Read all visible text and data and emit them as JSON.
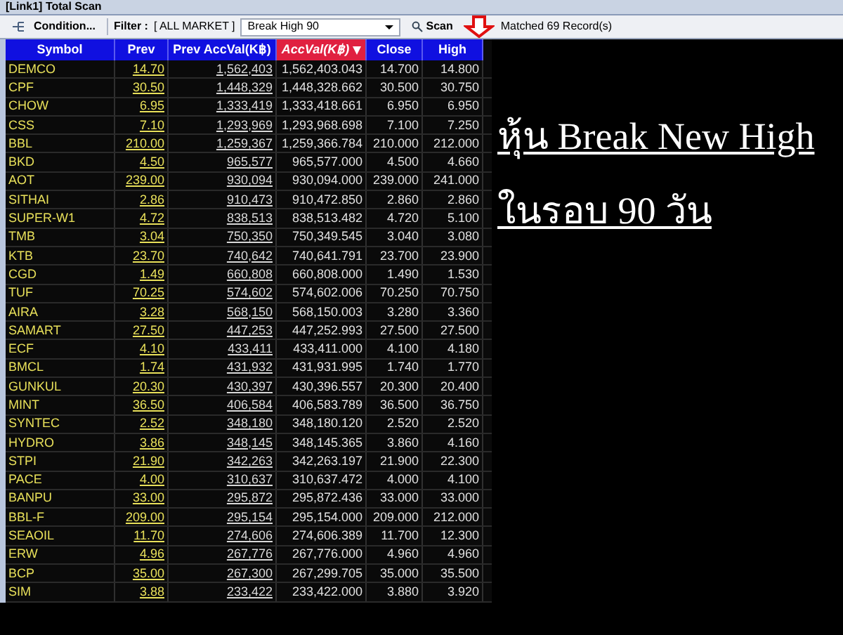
{
  "window": {
    "title": "[Link1] Total Scan"
  },
  "toolbar": {
    "condition_button": "Condition...",
    "filter_label": "Filter :",
    "market": "[ ALL MARKET ]",
    "scan_type": "Break High 90",
    "scan_button": "Scan",
    "result": "Matched 69 Record(s)"
  },
  "table": {
    "columns": [
      {
        "label": "Symbol",
        "sorted": false
      },
      {
        "label": "Prev",
        "sorted": false
      },
      {
        "label": "Prev AccVal(K฿)",
        "sorted": false
      },
      {
        "label": "AccVal(K฿)",
        "sorted": true
      },
      {
        "label": "Close",
        "sorted": false
      },
      {
        "label": "High",
        "sorted": false
      }
    ],
    "rows": [
      [
        "DEMCO",
        "14.70",
        "1,562,403",
        "1,562,403.043",
        "14.700",
        "14.800"
      ],
      [
        "CPF",
        "30.50",
        "1,448,329",
        "1,448,328.662",
        "30.500",
        "30.750"
      ],
      [
        "CHOW",
        "6.95",
        "1,333,419",
        "1,333,418.661",
        "6.950",
        "6.950"
      ],
      [
        "CSS",
        "7.10",
        "1,293,969",
        "1,293,968.698",
        "7.100",
        "7.250"
      ],
      [
        "BBL",
        "210.00",
        "1,259,367",
        "1,259,366.784",
        "210.000",
        "212.000"
      ],
      [
        "BKD",
        "4.50",
        "965,577",
        "965,577.000",
        "4.500",
        "4.660"
      ],
      [
        "AOT",
        "239.00",
        "930,094",
        "930,094.000",
        "239.000",
        "241.000"
      ],
      [
        "SITHAI",
        "2.86",
        "910,473",
        "910,472.850",
        "2.860",
        "2.860"
      ],
      [
        "SUPER-W1",
        "4.72",
        "838,513",
        "838,513.482",
        "4.720",
        "5.100"
      ],
      [
        "TMB",
        "3.04",
        "750,350",
        "750,349.545",
        "3.040",
        "3.080"
      ],
      [
        "KTB",
        "23.70",
        "740,642",
        "740,641.791",
        "23.700",
        "23.900"
      ],
      [
        "CGD",
        "1.49",
        "660,808",
        "660,808.000",
        "1.490",
        "1.530"
      ],
      [
        "TUF",
        "70.25",
        "574,602",
        "574,602.006",
        "70.250",
        "70.750"
      ],
      [
        "AIRA",
        "3.28",
        "568,150",
        "568,150.003",
        "3.280",
        "3.360"
      ],
      [
        "SAMART",
        "27.50",
        "447,253",
        "447,252.993",
        "27.500",
        "27.500"
      ],
      [
        "ECF",
        "4.10",
        "433,411",
        "433,411.000",
        "4.100",
        "4.180"
      ],
      [
        "BMCL",
        "1.74",
        "431,932",
        "431,931.995",
        "1.740",
        "1.770"
      ],
      [
        "GUNKUL",
        "20.30",
        "430,397",
        "430,396.557",
        "20.300",
        "20.400"
      ],
      [
        "MINT",
        "36.50",
        "406,584",
        "406,583.789",
        "36.500",
        "36.750"
      ],
      [
        "SYNTEC",
        "2.52",
        "348,180",
        "348,180.120",
        "2.520",
        "2.520"
      ],
      [
        "HYDRO",
        "3.86",
        "348,145",
        "348,145.365",
        "3.860",
        "4.160"
      ],
      [
        "STPI",
        "21.90",
        "342,263",
        "342,263.197",
        "21.900",
        "22.300"
      ],
      [
        "PACE",
        "4.00",
        "310,637",
        "310,637.472",
        "4.000",
        "4.100"
      ],
      [
        "BANPU",
        "33.00",
        "295,872",
        "295,872.436",
        "33.000",
        "33.000"
      ],
      [
        "BBL-F",
        "209.00",
        "295,154",
        "295,154.000",
        "209.000",
        "212.000"
      ],
      [
        "SEAOIL",
        "11.70",
        "274,606",
        "274,606.389",
        "11.700",
        "12.300"
      ],
      [
        "ERW",
        "4.96",
        "267,776",
        "267,776.000",
        "4.960",
        "4.960"
      ],
      [
        "BCP",
        "35.00",
        "267,300",
        "267,299.705",
        "35.000",
        "35.500"
      ],
      [
        "SIM",
        "3.88",
        "233,422",
        "233,422.000",
        "3.880",
        "3.920"
      ]
    ]
  },
  "caption": [
    "หุ้น Break New High",
    "ในรอบ 90 วัน"
  ]
}
